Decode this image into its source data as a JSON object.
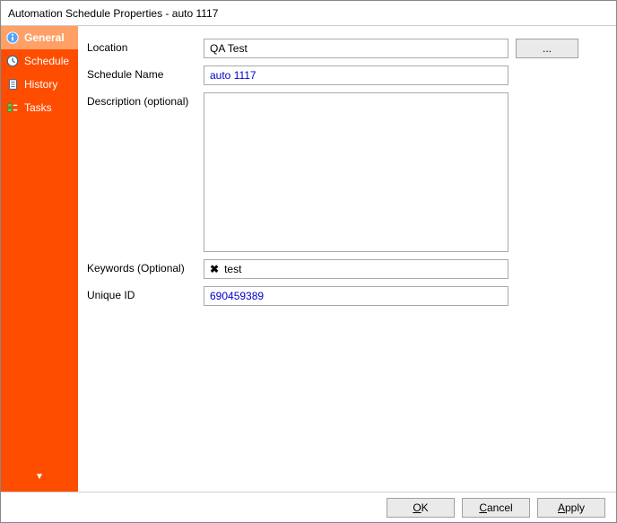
{
  "window": {
    "title": "Automation Schedule Properties - auto 1117"
  },
  "sidebar": {
    "items": [
      {
        "label": "General",
        "icon": "info-icon",
        "active": true
      },
      {
        "label": "Schedule",
        "icon": "clock-icon",
        "active": false
      },
      {
        "label": "History",
        "icon": "history-icon",
        "active": false
      },
      {
        "label": "Tasks",
        "icon": "tasks-icon",
        "active": false
      }
    ]
  },
  "form": {
    "location_label": "Location",
    "location_value": "QA Test",
    "browse_label": "...",
    "schedule_name_label": "Schedule Name",
    "schedule_name_value": "auto 1117",
    "description_label": "Description (optional)",
    "description_value": "",
    "keywords_label": "Keywords (Optional)",
    "keywords": [
      {
        "text": "test"
      }
    ],
    "unique_id_label": "Unique ID",
    "unique_id_value": "690459389"
  },
  "footer": {
    "ok": "OK",
    "cancel": "Cancel",
    "apply": "Apply"
  }
}
